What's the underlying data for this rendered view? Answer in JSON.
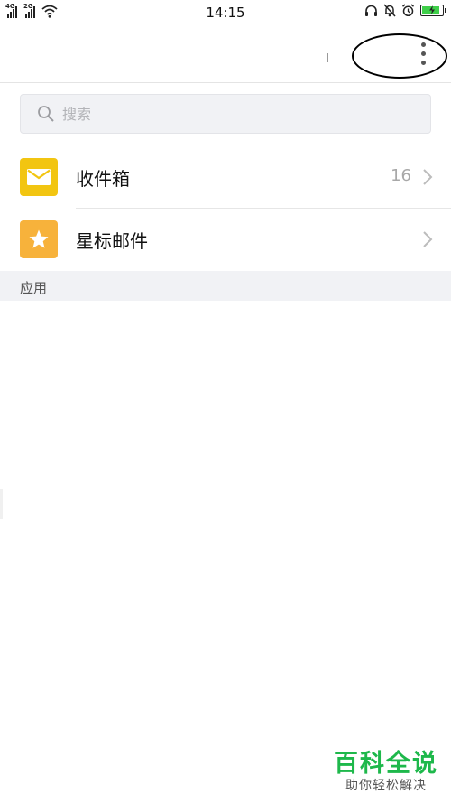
{
  "status_bar": {
    "time": "14:15",
    "sim1_tag": "4G",
    "sim2_tag": "2G",
    "icons": [
      "signal-icon",
      "wifi-icon",
      "headset-icon",
      "mute-icon",
      "alarm-icon",
      "battery-charging-icon"
    ],
    "battery_level": 0.8,
    "battery_color": "#3fcf4a"
  },
  "header": {
    "menu_icon": "more-vertical-icon"
  },
  "search": {
    "placeholder": "搜索",
    "value": ""
  },
  "folders": [
    {
      "label": "收件箱",
      "count": "16",
      "icon": "envelope-icon",
      "color": "#f2c511"
    },
    {
      "label": "星标邮件",
      "count": "",
      "icon": "star-icon",
      "color": "#f7b23b"
    }
  ],
  "section": {
    "apps_header": "应用"
  },
  "watermark": {
    "title": "百科全说",
    "subtitle": "助你轻松解决",
    "color": "#1eb84b"
  }
}
